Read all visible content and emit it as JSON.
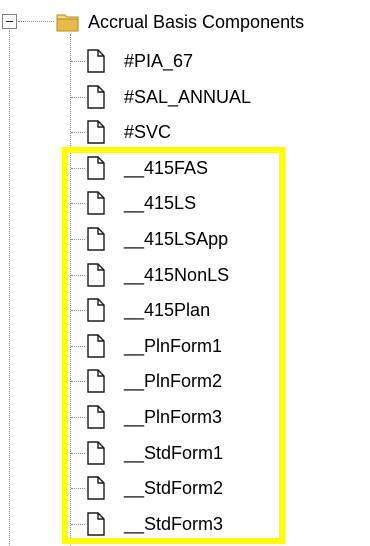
{
  "tree": {
    "root": {
      "label": "Accrual Basis Components",
      "icon": "folder-icon",
      "expanded": true
    },
    "children": [
      {
        "label": "#PIA_67",
        "icon": "document-icon"
      },
      {
        "label": "#SAL_ANNUAL",
        "icon": "document-icon"
      },
      {
        "label": "#SVC",
        "icon": "document-icon"
      },
      {
        "label": "__415FAS",
        "icon": "document-icon"
      },
      {
        "label": "__415LS",
        "icon": "document-icon"
      },
      {
        "label": "__415LSApp",
        "icon": "document-icon"
      },
      {
        "label": "__415NonLS",
        "icon": "document-icon"
      },
      {
        "label": "__415Plan",
        "icon": "document-icon"
      },
      {
        "label": "__PlnForm1",
        "icon": "document-icon"
      },
      {
        "label": "__PlnForm2",
        "icon": "document-icon"
      },
      {
        "label": "__PlnForm3",
        "icon": "document-icon"
      },
      {
        "label": "__StdForm1",
        "icon": "document-icon"
      },
      {
        "label": "__StdForm2",
        "icon": "document-icon"
      },
      {
        "label": "__StdForm3",
        "icon": "document-icon"
      }
    ]
  },
  "colors": {
    "highlight": "#ffff00",
    "folder": "#e8c35a",
    "guide": "#8a8a8a"
  }
}
